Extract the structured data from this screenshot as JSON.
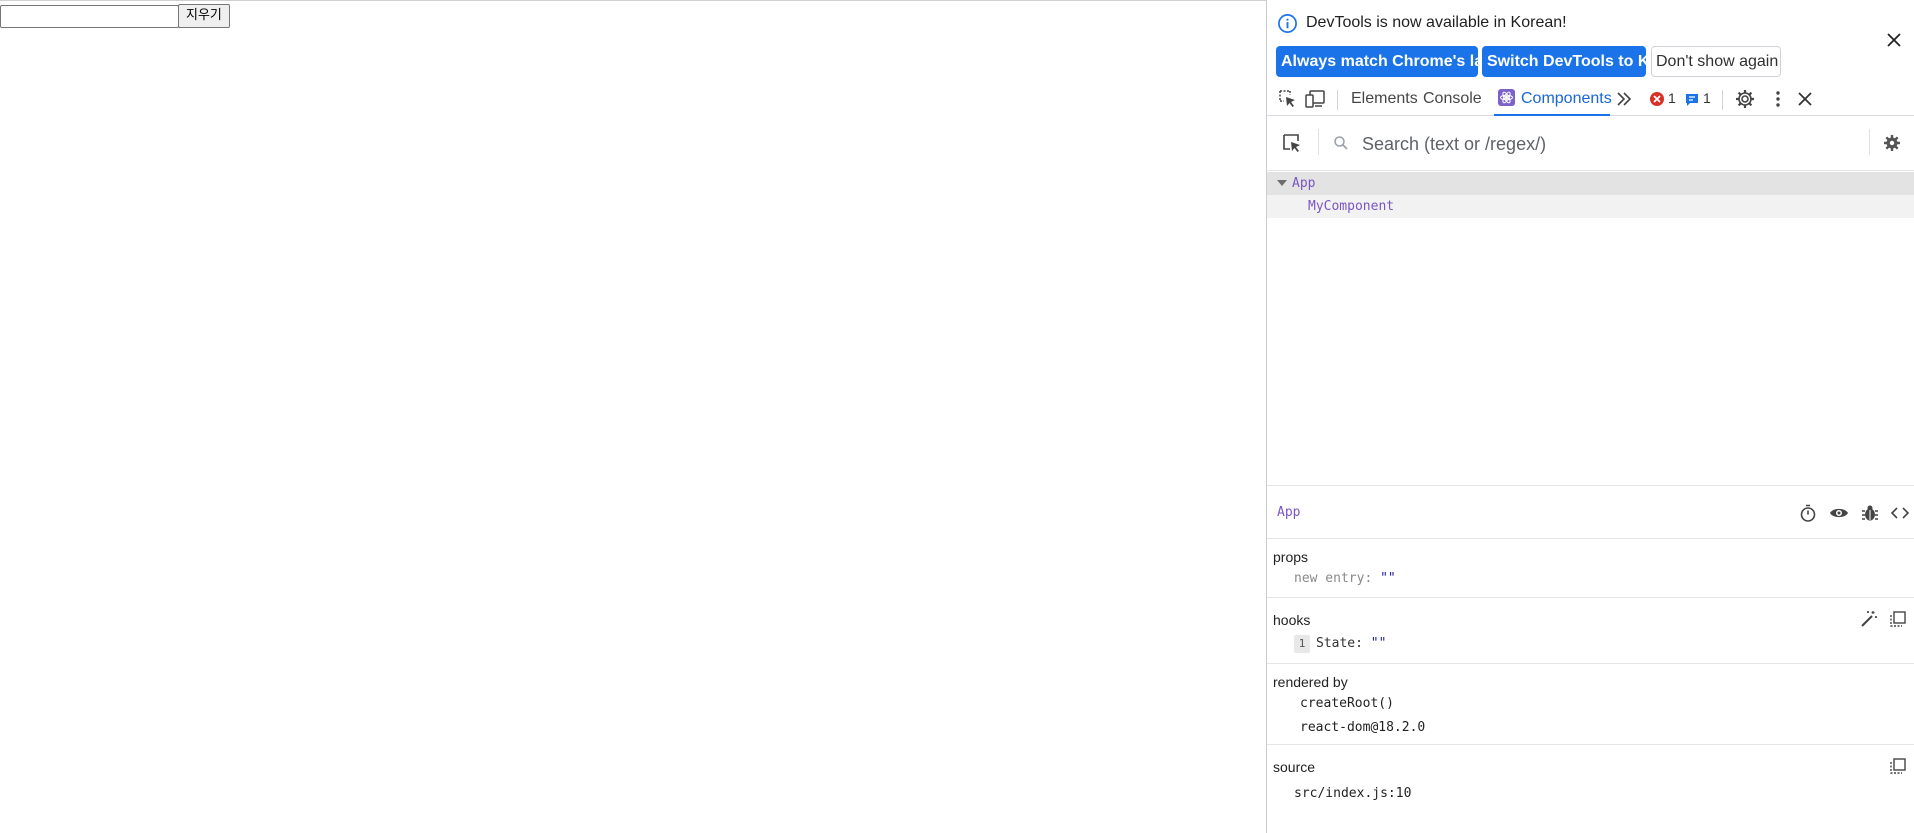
{
  "page": {
    "input_value": "",
    "clear_button_label": "지우기"
  },
  "devtools": {
    "infobar": {
      "message": "DevTools is now available in Korean!",
      "match_language_label": "Always match Chrome's language",
      "switch_language_label": "Switch DevTools to Korean",
      "dont_show_label": "Don't show again"
    },
    "tabs": {
      "elements": "Elements",
      "console": "Console",
      "components": "Components",
      "error_count": "1",
      "message_count": "1"
    },
    "search": {
      "placeholder": "Search (text or /regex/)"
    },
    "tree": {
      "root": "App",
      "child": "MyComponent"
    },
    "inspected": {
      "name": "App",
      "props": {
        "title": "props",
        "key": "new entry",
        "value": "\"\""
      },
      "hooks": {
        "title": "hooks",
        "index": "1",
        "key": "State",
        "value": "\"\""
      },
      "rendered_by": {
        "title": "rendered by",
        "items": [
          "createRoot()",
          "react-dom@18.2.0"
        ]
      },
      "source": {
        "title": "source",
        "location": "src/index.js:10"
      }
    }
  },
  "colors": {
    "accent": "#1a73e8",
    "component_name": "#7a55c4",
    "string_value": "#1a1aa6"
  }
}
